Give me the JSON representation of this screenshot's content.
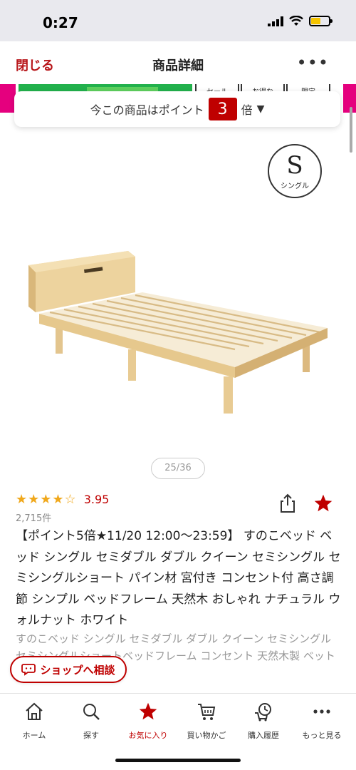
{
  "status_bar": {
    "time": "0:27",
    "battery_color": "#f5c400"
  },
  "header": {
    "close_label": "閉じる",
    "title": "商品詳細",
    "more_icon": "ellipsis-icon"
  },
  "banner": {
    "tags": [
      "セール",
      "お得な",
      "限定"
    ]
  },
  "points": {
    "prefix": "今この商品はポイント",
    "multiplier": "3",
    "suffix": "倍"
  },
  "size_badge": {
    "letter": "S",
    "label": "シングル"
  },
  "gallery": {
    "indicator": "25/36",
    "current": 25,
    "total": 36
  },
  "rating": {
    "stars": "★★★★☆",
    "value": "3.95",
    "count": "2,715件"
  },
  "product": {
    "title": "【ポイント5倍★11/20 12:00〜23:59】 すのこベッド ベッド シングル セミダブル ダブル クイーン セミシングル セミシングルショート パイン材 宮付き コンセント付 高さ調節 シンプル ベッドフレーム 天然木 おしゃれ ナチュラル ウォルナット ホワイト",
    "subtitle": "すのこベッド シングル セミダブル ダブル クイーン セミシングル セミシングルショートベッドフレーム コンセント 天然木製 ベット 北欧風"
  },
  "consult_button": {
    "label": "ショップへ相談"
  },
  "nav": [
    {
      "label": "ホーム",
      "icon": "home-icon"
    },
    {
      "label": "探す",
      "icon": "search-icon"
    },
    {
      "label": "お気に入り",
      "icon": "star-icon"
    },
    {
      "label": "買い物かご",
      "icon": "cart-icon"
    },
    {
      "label": "購入履歴",
      "icon": "history-icon"
    },
    {
      "label": "もっと見る",
      "icon": "more-icon"
    }
  ],
  "colors": {
    "brand_red": "#bf0000",
    "star_orange": "#f0a81c"
  }
}
